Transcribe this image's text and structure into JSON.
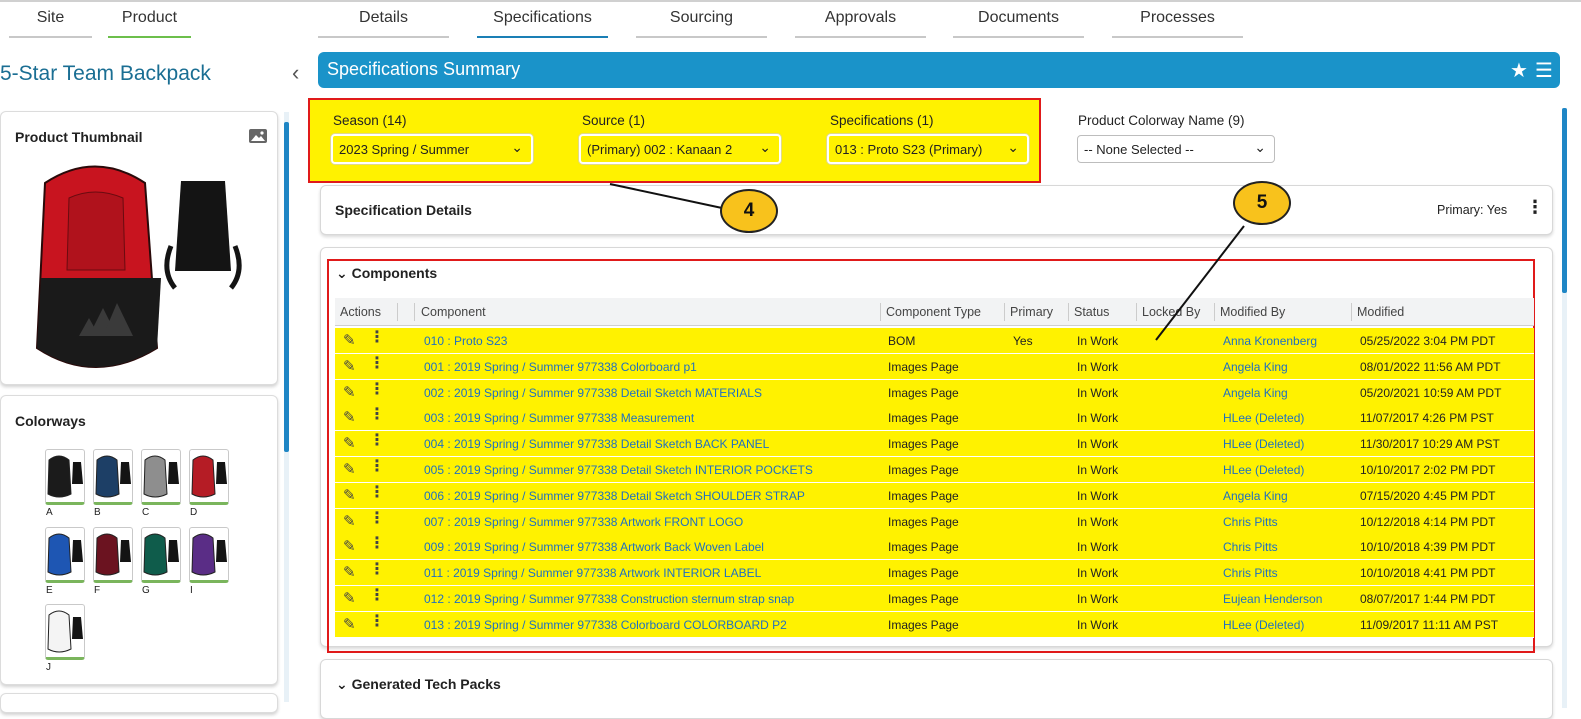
{
  "top_tabs": {
    "left": [
      {
        "label": "Site"
      },
      {
        "label": "Product"
      }
    ],
    "main": [
      {
        "label": "Details"
      },
      {
        "label": "Specifications"
      },
      {
        "label": "Sourcing"
      },
      {
        "label": "Approvals"
      },
      {
        "label": "Documents"
      },
      {
        "label": "Processes"
      }
    ]
  },
  "product": {
    "title": "5-Star Team Backpack",
    "thumbnail_title": "Product Thumbnail",
    "colorways_title": "Colorways",
    "colorways": [
      {
        "label": "A",
        "color": "#1b1b1b"
      },
      {
        "label": "B",
        "color": "#1d3f66"
      },
      {
        "label": "C",
        "color": "#8e8e8e"
      },
      {
        "label": "D",
        "color": "#b51c25"
      },
      {
        "label": "E",
        "color": "#1e56b3"
      },
      {
        "label": "F",
        "color": "#6b1320"
      },
      {
        "label": "G",
        "color": "#0f5c4b"
      },
      {
        "label": "I",
        "color": "#5a2d86"
      },
      {
        "label": "J",
        "color": "#f4f4f4"
      }
    ]
  },
  "summary": {
    "title": "Specifications Summary"
  },
  "filters": {
    "season": {
      "label": "Season (14)",
      "value": "2023 Spring / Summer"
    },
    "source": {
      "label": "Source (1)",
      "value": "(Primary) 002 : Kanaan 2"
    },
    "specifications": {
      "label": "Specifications (1)",
      "value": "013 : Proto S23 (Primary)"
    },
    "colorway": {
      "label": "Product Colorway Name (9)",
      "value": "-- None Selected --"
    }
  },
  "spec_details": {
    "title": "Specification Details",
    "primary": "Primary: Yes"
  },
  "callouts": {
    "four": "4",
    "five": "5"
  },
  "components": {
    "title": "Components",
    "columns": [
      "Actions",
      "Component",
      "Component Type",
      "Primary",
      "Status",
      "Locked By",
      "Modified By",
      "Modified"
    ],
    "rows": [
      {
        "component": "010 : Proto S23",
        "type": "BOM",
        "primary": "Yes",
        "status": "In Work",
        "modified_by": "Anna Kronenberg",
        "modified": "05/25/2022 3:04 PM PDT"
      },
      {
        "component": "001 : 2019 Spring / Summer  977338 Colorboard p1",
        "type": "Images Page",
        "primary": "",
        "status": "In Work",
        "modified_by": "Angela King",
        "modified": "08/01/2022 11:56 AM PDT"
      },
      {
        "component": "002 : 2019 Spring / Summer  977338 Detail Sketch MATERIALS",
        "type": "Images Page",
        "primary": "",
        "status": "In Work",
        "modified_by": "Angela King",
        "modified": "05/20/2021 10:59 AM PDT"
      },
      {
        "component": "003 : 2019 Spring / Summer  977338 Measurement",
        "type": "Images Page",
        "primary": "",
        "status": "In Work",
        "modified_by": "HLee (Deleted)",
        "modified": "11/07/2017 4:26 PM PST"
      },
      {
        "component": "004 : 2019 Spring / Summer  977338 Detail Sketch BACK PANEL",
        "type": "Images Page",
        "primary": "",
        "status": "In Work",
        "modified_by": "HLee (Deleted)",
        "modified": "11/30/2017 10:29 AM PST"
      },
      {
        "component": "005 : 2019 Spring / Summer  977338 Detail Sketch INTERIOR POCKETS",
        "type": "Images Page",
        "primary": "",
        "status": "In Work",
        "modified_by": "HLee (Deleted)",
        "modified": "10/10/2017 2:02 PM PDT"
      },
      {
        "component": "006 : 2019 Spring / Summer  977338 Detail Sketch SHOULDER STRAP",
        "type": "Images Page",
        "primary": "",
        "status": "In Work",
        "modified_by": "Angela King",
        "modified": "07/15/2020 4:45 PM PDT"
      },
      {
        "component": "007 : 2019 Spring / Summer  977338 Artwork FRONT LOGO",
        "type": "Images Page",
        "primary": "",
        "status": "In Work",
        "modified_by": "Chris Pitts",
        "modified": "10/12/2018 4:14 PM PDT"
      },
      {
        "component": "009 : 2019 Spring / Summer  977338 Artwork Back Woven Label",
        "type": "Images Page",
        "primary": "",
        "status": "In Work",
        "modified_by": "Chris Pitts",
        "modified": "10/10/2018 4:39 PM PDT"
      },
      {
        "component": "011 : 2019 Spring / Summer  977338 Artwork INTERIOR LABEL",
        "type": "Images Page",
        "primary": "",
        "status": "In Work",
        "modified_by": "Chris Pitts",
        "modified": "10/10/2018 4:41 PM PDT"
      },
      {
        "component": "012 : 2019 Spring / Summer  977338 Construction sternum strap snap",
        "type": "Images Page",
        "primary": "",
        "status": "In Work",
        "modified_by": "Eujean Henderson",
        "modified": "08/07/2017 1:44 PM PDT"
      },
      {
        "component": "013 : 2019 Spring / Summer  977338 Colorboard COLORBOARD P2",
        "type": "Images Page",
        "primary": "",
        "status": "In Work",
        "modified_by": "HLee (Deleted)",
        "modified": "11/09/2017 11:11 AM PST"
      }
    ]
  },
  "generated": {
    "title": "Generated Tech Packs"
  },
  "colors": {
    "accent": "#1a93c9",
    "highlight": "#fff200",
    "annotation_border": "#e01a1a",
    "link": "#1f70c1",
    "callout": "#f8c21c"
  }
}
